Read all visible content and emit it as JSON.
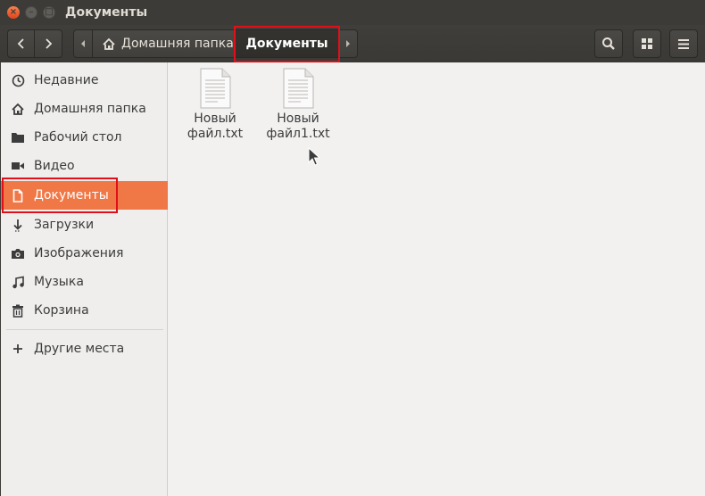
{
  "window": {
    "title": "Документы",
    "controls": [
      "close-icon",
      "minimize-icon",
      "maximize-icon"
    ]
  },
  "toolbar": {
    "breadcrumb": {
      "home_label": "Домашняя папка",
      "current_label": "Документы"
    },
    "icons": [
      "chevron-left-icon",
      "chevron-right-icon",
      "search-icon",
      "grid-view-icon",
      "hamburger-menu-icon"
    ]
  },
  "sidebar": {
    "items": [
      {
        "label": "Недавние",
        "icon": "clock-icon"
      },
      {
        "label": "Домашняя папка",
        "icon": "home-icon"
      },
      {
        "label": "Рабочий стол",
        "icon": "folder-icon"
      },
      {
        "label": "Видео",
        "icon": "video-icon"
      },
      {
        "label": "Документы",
        "icon": "document-icon",
        "active": true
      },
      {
        "label": "Загрузки",
        "icon": "download-icon"
      },
      {
        "label": "Изображения",
        "icon": "camera-icon"
      },
      {
        "label": "Музыка",
        "icon": "music-icon"
      },
      {
        "label": "Корзина",
        "icon": "trash-icon"
      }
    ],
    "other": {
      "label": "Другие места",
      "icon": "plus-icon"
    }
  },
  "files": [
    {
      "line1": "Новый",
      "line2": "файл.txt",
      "icon": "text-file-icon"
    },
    {
      "line1": "Новый",
      "line2": "файл1.txt",
      "icon": "text-file-icon"
    }
  ],
  "colors": {
    "accent": "#f07746",
    "highlight": "#e0101a",
    "titlebar": "#3c3b37"
  }
}
